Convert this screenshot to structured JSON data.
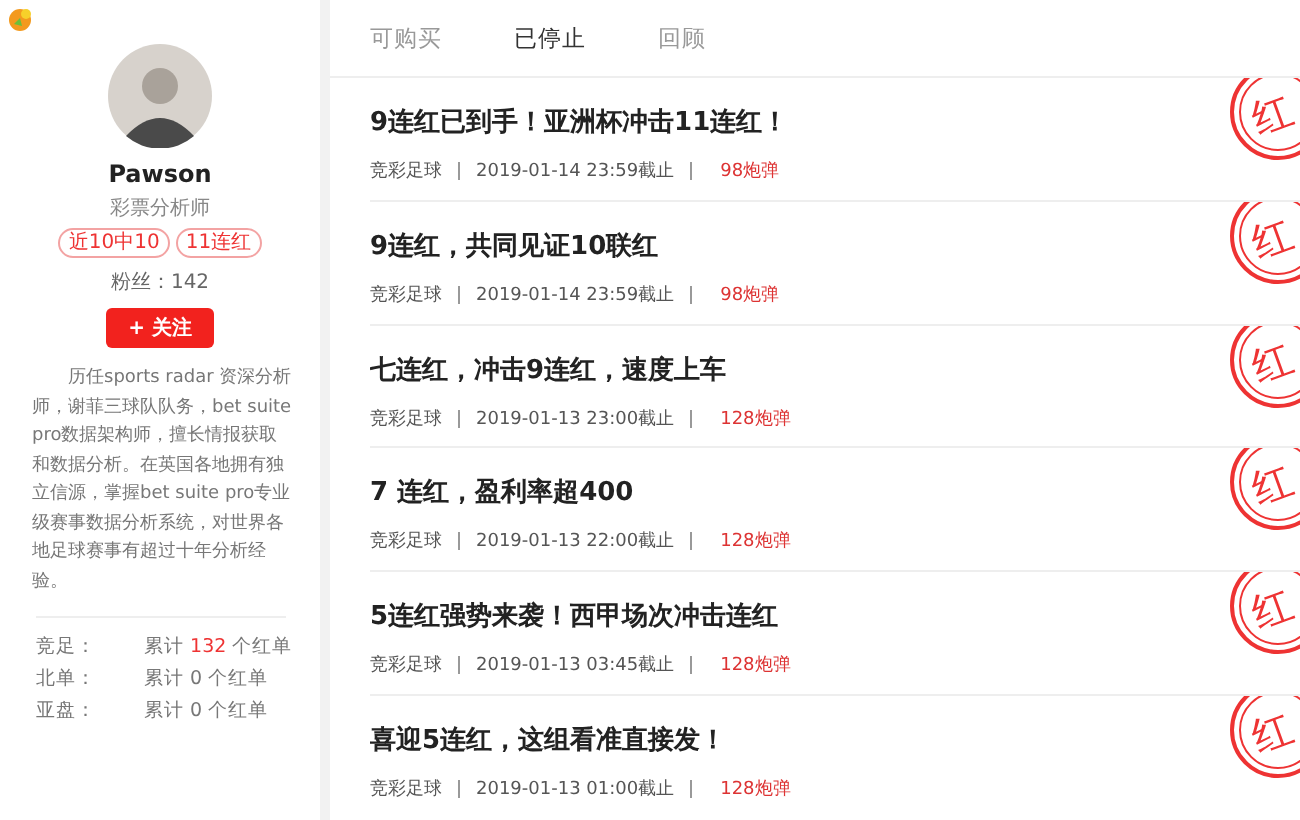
{
  "profile": {
    "name": "Pawson",
    "title": "彩票分析师",
    "tags": [
      "近10中10",
      "11连红"
    ],
    "fans_label": "粉丝：",
    "fans": "142",
    "follow_button": "+ 关注",
    "bio": "历任sports radar 资深分析师，谢菲三球队队务，bet suite pro数据架构师，擅长情报获取和数据分析。在英国各地拥有独立信源，掌握bet suite pro专业级赛事数据分析系统，对世界各地足球赛事有超过十年分析经验。",
    "stats": [
      {
        "label": "竞足：",
        "prefix": "累计",
        "count": "132",
        "suffix": "个红单",
        "highlight": true
      },
      {
        "label": "北单：",
        "prefix": "累计",
        "count": "0",
        "suffix": "个红单",
        "highlight": false
      },
      {
        "label": "亚盘：",
        "prefix": "累计",
        "count": "0",
        "suffix": "个红单",
        "highlight": false
      }
    ]
  },
  "tabs": [
    {
      "label": "可购买",
      "selected": false
    },
    {
      "label": "已停止",
      "selected": true
    },
    {
      "label": "回顾",
      "selected": false
    }
  ],
  "articles": [
    {
      "title": "9连红已到手！亚洲杯冲击11连红！",
      "category": "竞彩足球",
      "deadline": "2019-01-14 23:59截止",
      "price": "98炮弹",
      "stamp": "红"
    },
    {
      "title": "9连红，共同见证10联红",
      "category": "竞彩足球",
      "deadline": "2019-01-14 23:59截止",
      "price": "98炮弹",
      "stamp": "红"
    },
    {
      "title": "七连红，冲击9连红，速度上车",
      "category": "竞彩足球",
      "deadline": "2019-01-13 23:00截止",
      "price": "128炮弹",
      "stamp": "红"
    },
    {
      "title": "7 连红，盈利率超400",
      "category": "竞彩足球",
      "deadline": "2019-01-13 22:00截止",
      "price": "128炮弹",
      "stamp": "红"
    },
    {
      "title": "5连红强势来袭！西甲场次冲击连红",
      "category": "竞彩足球",
      "deadline": "2019-01-13 03:45截止",
      "price": "128炮弹",
      "stamp": "红"
    },
    {
      "title": "喜迎5连红，这组看准直接发！",
      "category": "竞彩足球",
      "deadline": "2019-01-13 01:00截止",
      "price": "128炮弹",
      "stamp": "红"
    }
  ]
}
